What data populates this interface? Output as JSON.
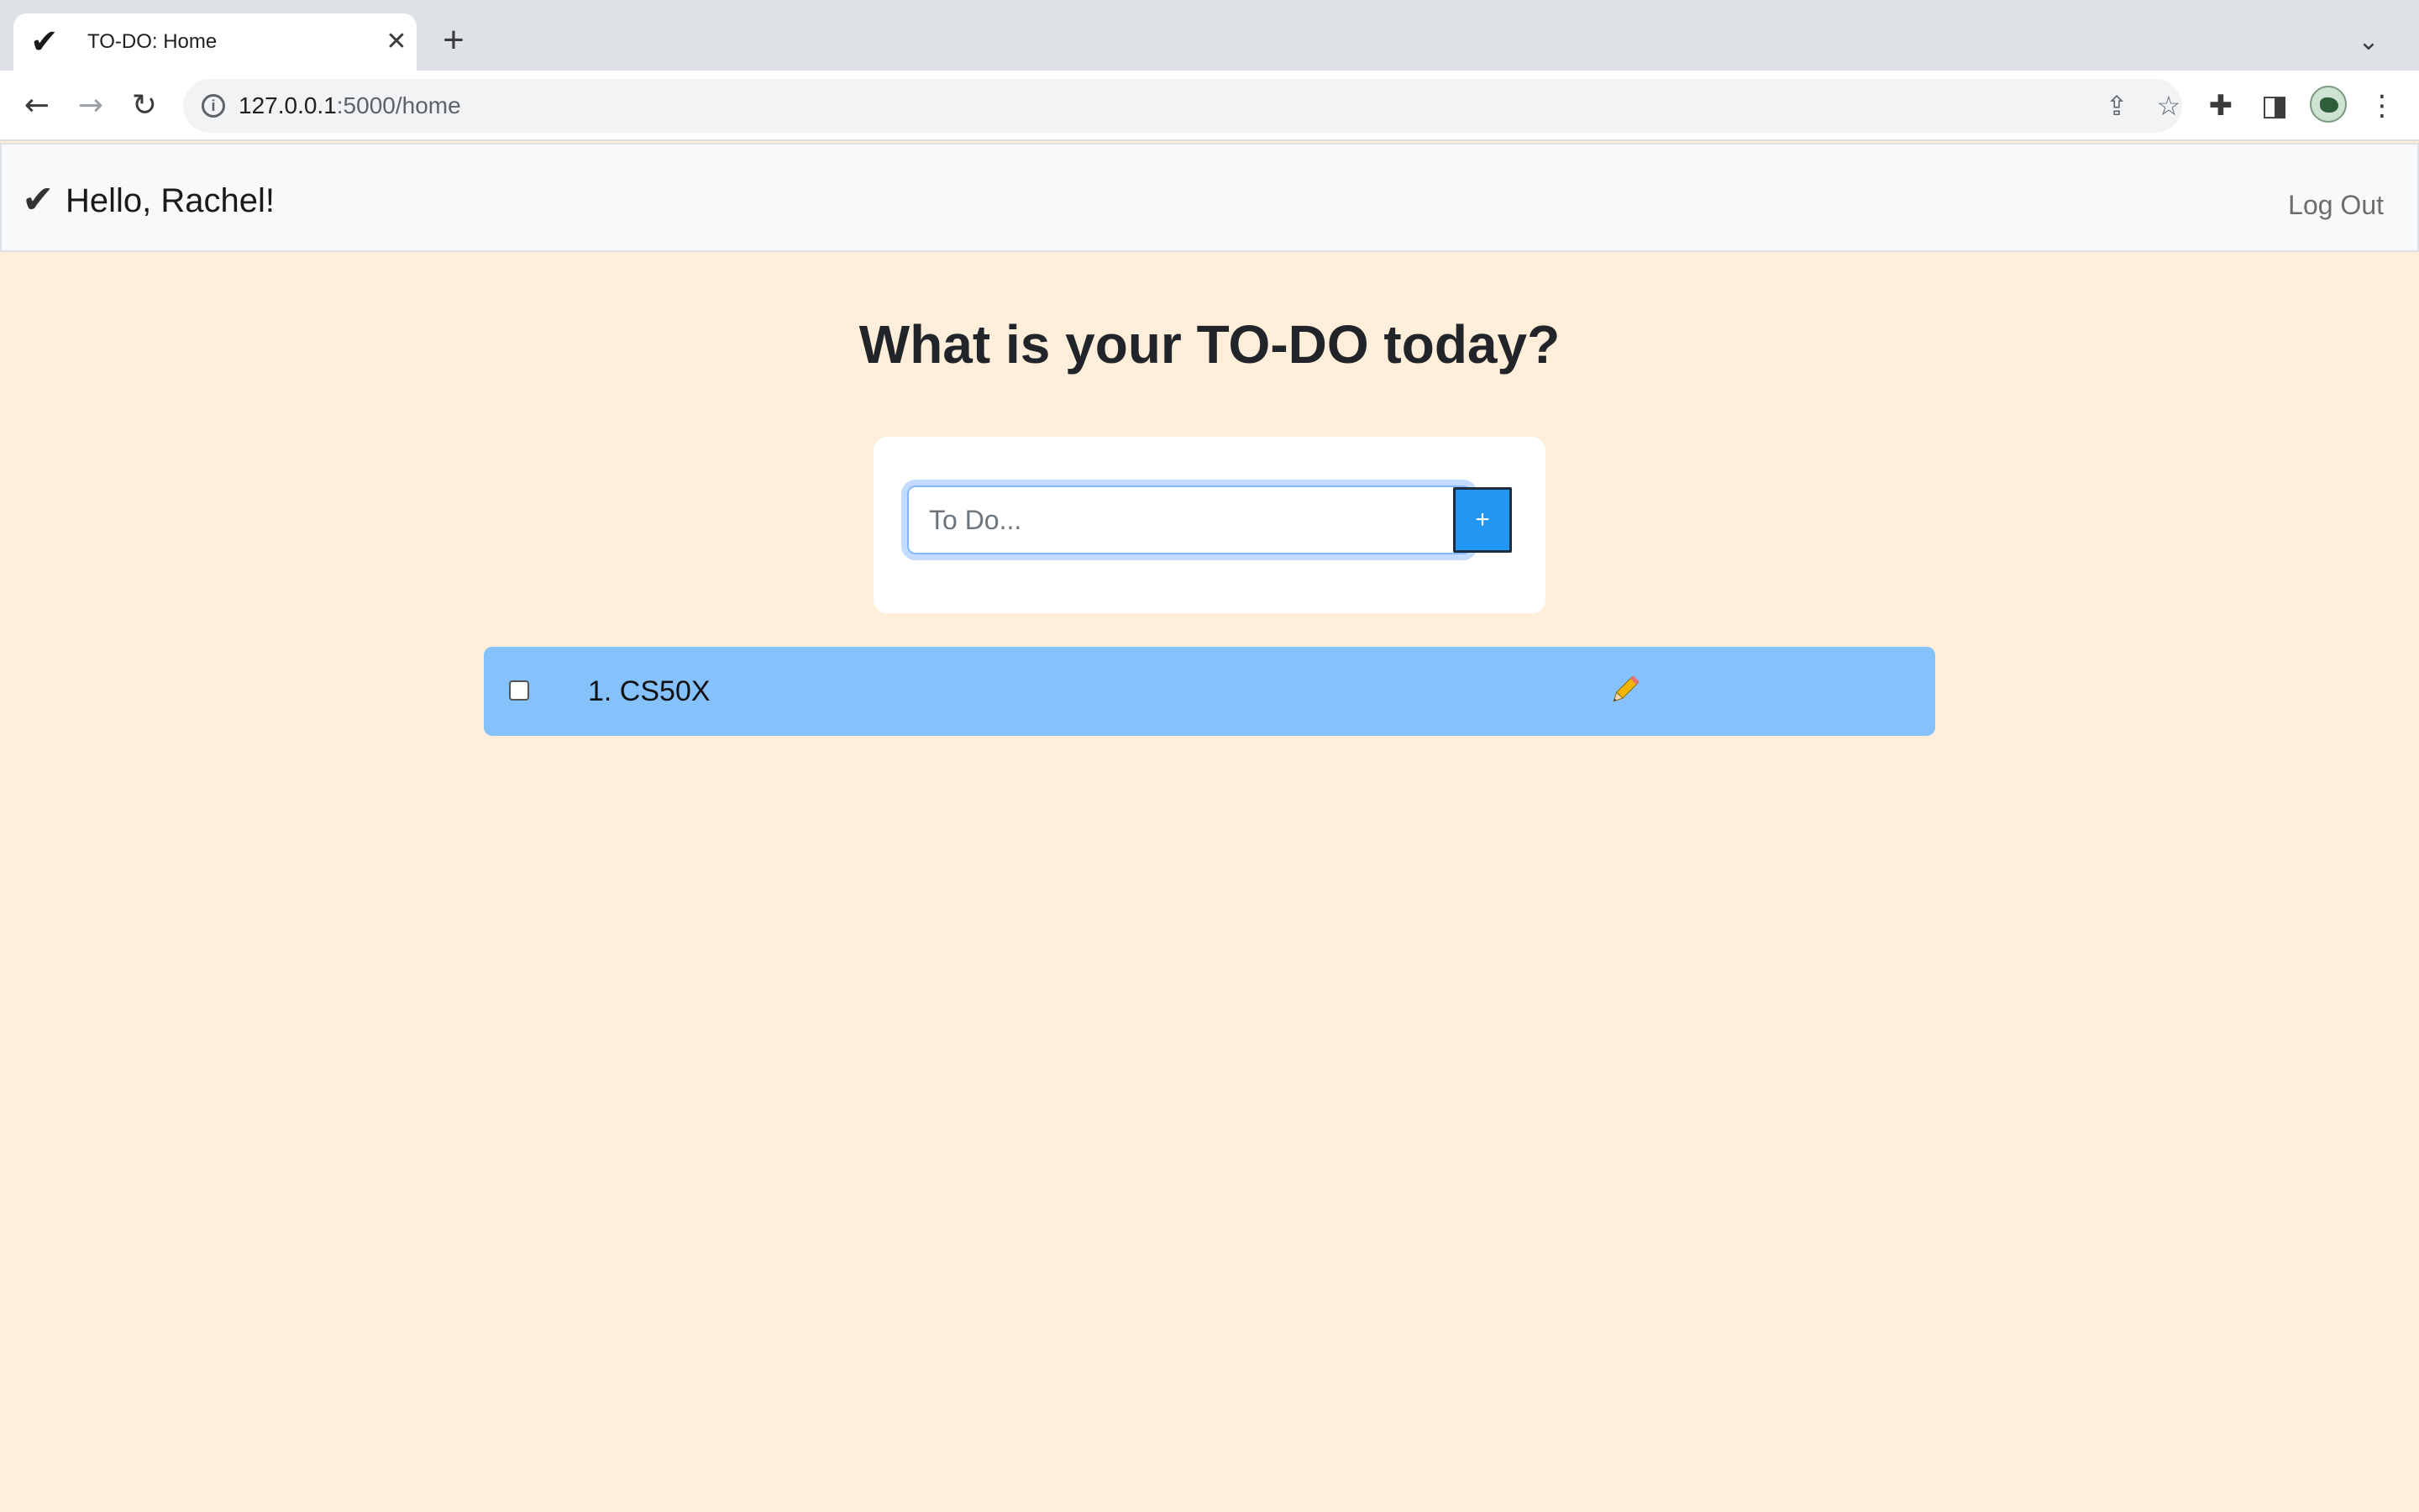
{
  "browser": {
    "tab_title": "TO-DO: Home",
    "tab_favicon": "✔",
    "tab_close": "✕",
    "new_tab": "+",
    "tab_dropdown": "⌄",
    "url_host": "127.0.0.1",
    "url_path": ":5000/home",
    "back": "←",
    "forward": "→",
    "reload": "↻",
    "icons": [
      "info-icon",
      "share-icon",
      "star-icon",
      "extensions-icon",
      "side-panel-icon",
      "profile-avatar",
      "menu-icon"
    ]
  },
  "navbar": {
    "brand_check": "✔",
    "brand_text": "Hello, Rachel!",
    "logout_label": "Log Out"
  },
  "main": {
    "heading": "What is your TO-DO today?",
    "input_placeholder": "To Do...",
    "add_label": "+",
    "todos": [
      {
        "index_label": "1. CS50X",
        "checked": false
      }
    ]
  },
  "colors": {
    "page_background": "#ffeed9",
    "todo_row": "#85c1fb",
    "add_button": "#2196f3"
  }
}
